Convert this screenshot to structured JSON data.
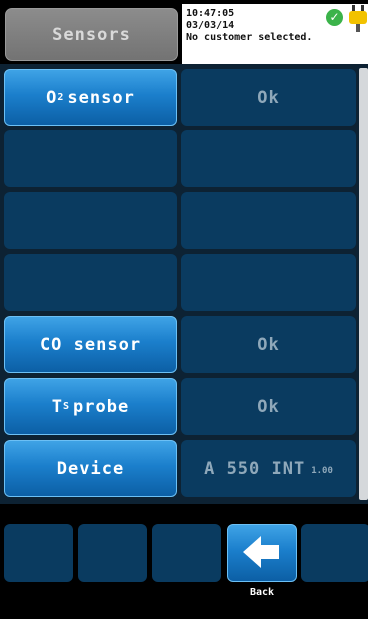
{
  "header": {
    "title": "Sensors",
    "time": "10:47:05",
    "date": "03/03/14",
    "customer": "No customer selected."
  },
  "rows": [
    {
      "label_main": "O",
      "label_sub": "2",
      "label_rest": " sensor",
      "value": "Ok"
    },
    {
      "label_main": "",
      "label_sub": "",
      "label_rest": "",
      "value": ""
    },
    {
      "label_main": "",
      "label_sub": "",
      "label_rest": "",
      "value": ""
    },
    {
      "label_main": "",
      "label_sub": "",
      "label_rest": "",
      "value": ""
    },
    {
      "label_main": "CO sensor",
      "label_sub": "",
      "label_rest": "",
      "value": "Ok"
    },
    {
      "label_main": "T",
      "label_sub": "S",
      "label_rest": "probe",
      "value": "Ok"
    },
    {
      "label_main": "Device",
      "label_sub": "",
      "label_rest": "",
      "value": "A 550 INT",
      "value_small": "1.00"
    }
  ],
  "footer": {
    "back_label": "Back"
  },
  "icons": {
    "status_ok": "check-icon",
    "power": "plug-icon",
    "back": "arrow-left-icon"
  },
  "colors": {
    "accent": "#1b7fcc",
    "cell": "#0a3b60",
    "panel": "#0d2233",
    "ok_green": "#3bb34a",
    "plug_yellow": "#f2c200"
  }
}
